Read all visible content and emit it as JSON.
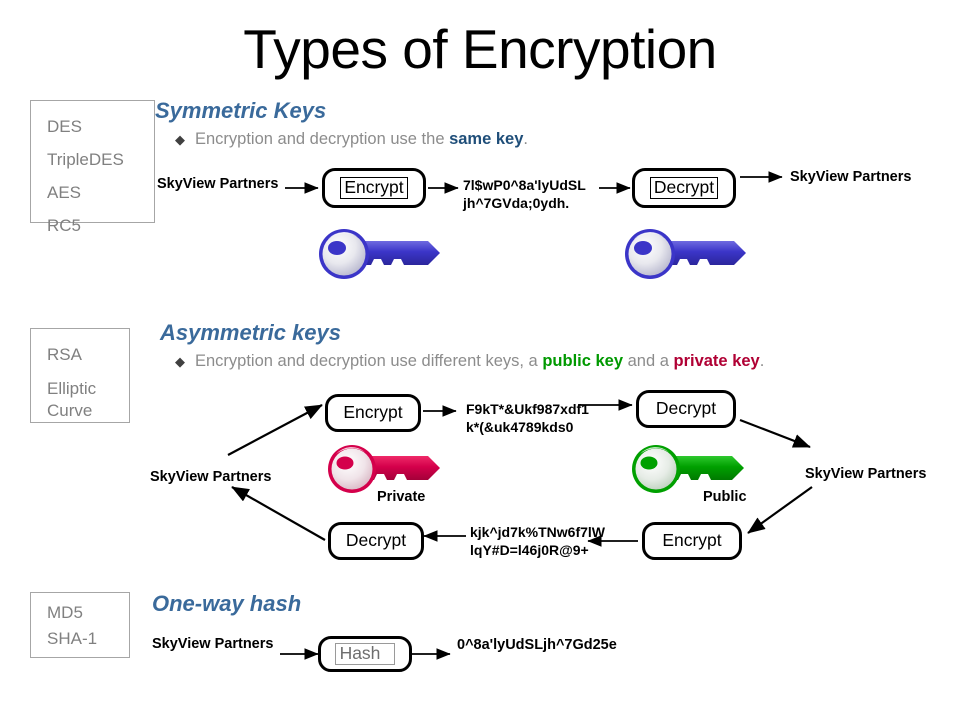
{
  "title": "Types of Encryption",
  "sections": {
    "symmetric": {
      "heading": "Symmetric Keys",
      "bullet_prefix": "Encryption and decryption use the ",
      "bullet_keyword": "same key",
      "bullet_suffix": ".",
      "algorithms": [
        "DES",
        "TripleDES",
        "AES",
        "RC5"
      ],
      "input_label": "SkyView Partners",
      "encrypt_label": "Encrypt",
      "ciphertext": "7l$wP0^8a'lyUdSL\njh^7GVda;0ydh.",
      "decrypt_label": "Decrypt",
      "output_label": "SkyView Partners",
      "key_left_color": "#3b35c8",
      "key_right_color": "#3b35c8"
    },
    "asymmetric": {
      "heading": "Asymmetric keys",
      "bullet_prefix": "Encryption and decryption use different keys, a ",
      "bullet_keyword_public": "public key",
      "bullet_middle": " and a ",
      "bullet_keyword_private": "private key",
      "bullet_suffix": ".",
      "algorithms": [
        "RSA",
        "Elliptic",
        "Curve"
      ],
      "top_input_label": "SkyView Partners",
      "top_encrypt_label": "Encrypt",
      "top_ciphertext": "F9kT*&Ukf987xdf1\nk*(&uk4789kds0",
      "top_decrypt_label": "Decrypt",
      "top_output_label": "SkyView Partners",
      "bottom_encrypt_label": "Encrypt",
      "bottom_ciphertext": "kjk^jd7k%TNw6f7lW\nlqY#D=l46j0R@9+",
      "bottom_decrypt_label": "Decrypt",
      "private_key_label": "Private",
      "public_key_label": "Public",
      "private_key_color": "#d4004b",
      "public_key_color": "#00a000"
    },
    "hash": {
      "heading": "One-way hash",
      "algorithms": [
        "MD5",
        "SHA-1"
      ],
      "input_label": "SkyView Partners",
      "hash_label": "Hash",
      "digest": "0^8a'lyUdSLjh^7Gd25e"
    }
  },
  "colors": {
    "heading": "#3a6a9b",
    "body_text": "#8c8c8c",
    "blue_keyword": "#1f4e79",
    "green_keyword": "#009900",
    "crimson_keyword": "#b00034",
    "box_border": "#a6a6a6"
  }
}
